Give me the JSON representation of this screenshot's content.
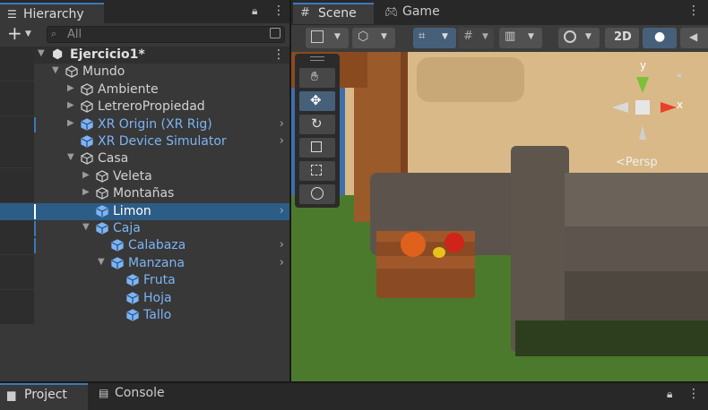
{
  "hierarchy": {
    "tab_label": "Hierarchy",
    "add_label": "+",
    "search_placeholder": "All",
    "scene_name": "Ejercicio1*",
    "rows": [
      {
        "label": "Mundo"
      },
      {
        "label": "Ambiente"
      },
      {
        "label": "LetreroPropiedad"
      },
      {
        "label": "XR Origin (XR Rig)"
      },
      {
        "label": "XR Device Simulator"
      },
      {
        "label": "Casa"
      },
      {
        "label": "Veleta"
      },
      {
        "label": "Montañas"
      },
      {
        "label": "Limon"
      },
      {
        "label": "Caja"
      },
      {
        "label": "Calabaza"
      },
      {
        "label": "Manzana"
      },
      {
        "label": "Fruta"
      },
      {
        "label": "Hoja"
      },
      {
        "label": "Tallo"
      }
    ]
  },
  "scene": {
    "tab_scene": "Scene",
    "tab_game": "Game",
    "btn_2d": "2D",
    "persp_label": "<Persp",
    "gizmo_y": "y",
    "gizmo_x": "x"
  },
  "bottom": {
    "tab_project": "Project",
    "tab_console": "Console"
  },
  "colors": {
    "accent": "#3a79bb",
    "prefab_blue": "#7cb4f5",
    "selection": "#2c5d87"
  }
}
